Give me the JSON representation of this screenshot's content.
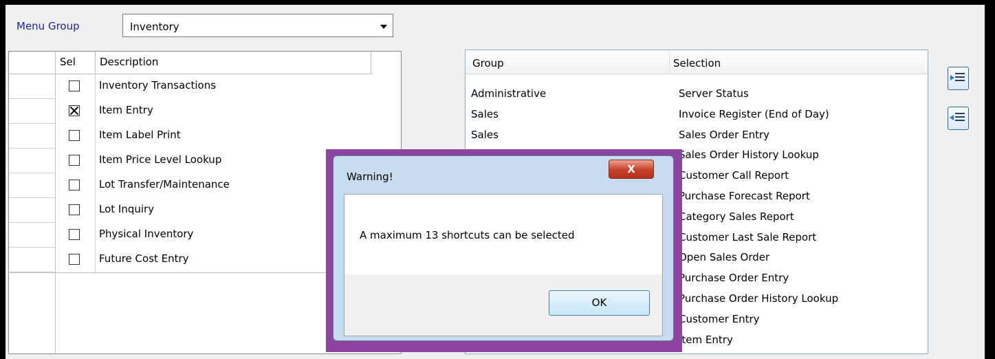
{
  "menu_group": {
    "label": "Menu Group",
    "value": "Inventory"
  },
  "left_grid": {
    "headers": {
      "sel": "Sel",
      "description": "Description"
    },
    "rows": [
      {
        "checked": false,
        "label": "Inventory Transactions"
      },
      {
        "checked": true,
        "label": "Item Entry"
      },
      {
        "checked": false,
        "label": "Item Label Print"
      },
      {
        "checked": false,
        "label": "Item Price Level Lookup"
      },
      {
        "checked": false,
        "label": "Lot Transfer/Maintenance"
      },
      {
        "checked": false,
        "label": "Lot Inquiry"
      },
      {
        "checked": false,
        "label": "Physical Inventory"
      },
      {
        "checked": false,
        "label": "Future Cost Entry"
      }
    ]
  },
  "right_grid": {
    "headers": {
      "group": "Group",
      "selection": "Selection"
    },
    "rows": [
      {
        "group": "Administrative",
        "selection": "Server Status"
      },
      {
        "group": "Sales",
        "selection": "Invoice Register (End of Day)"
      },
      {
        "group": "Sales",
        "selection": "Sales Order Entry"
      },
      {
        "group": "",
        "selection": "Sales Order History Lookup"
      },
      {
        "group": "",
        "selection": "Customer Call Report"
      },
      {
        "group": "",
        "selection": "Purchase Forecast Report"
      },
      {
        "group": "",
        "selection": "Category Sales Report"
      },
      {
        "group": "",
        "selection": "Customer Last Sale Report"
      },
      {
        "group": "",
        "selection": "Open Sales Order"
      },
      {
        "group": "",
        "selection": "Purchase Order Entry"
      },
      {
        "group": "",
        "selection": "Purchase Order History Lookup"
      },
      {
        "group": "",
        "selection": "Customer Entry"
      },
      {
        "group": "",
        "selection": "Item Entry"
      }
    ]
  },
  "side_buttons": {
    "add_icon": "add-to-list-icon",
    "remove_icon": "remove-from-list-icon"
  },
  "dialog": {
    "title": "Warning!",
    "close_glyph": "X",
    "message": "A maximum 13 shortcuts can be selected",
    "ok_label": "OK"
  },
  "colors": {
    "overlay_border": "#8e44a1",
    "menu_label": "#1f1fa0",
    "close_button": "#c8412a"
  }
}
